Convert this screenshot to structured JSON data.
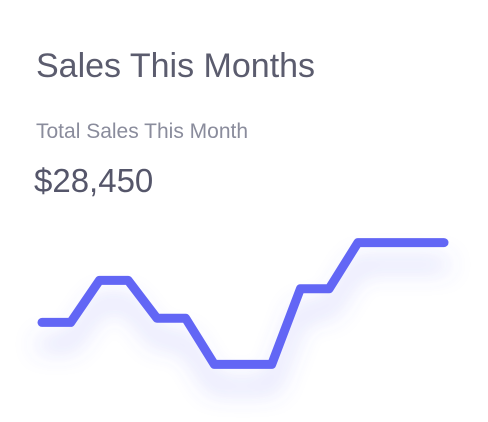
{
  "card": {
    "title": "Sales This Months",
    "subtitle": "Total Sales This Month",
    "value": "$28,450"
  },
  "colors": {
    "title": "#5b5c6e",
    "subtitle": "#8a8c9c",
    "value": "#55566a",
    "line": "#6266f5",
    "shadow": "#6266f5",
    "background": "#ffffff"
  },
  "chart_data": {
    "type": "line",
    "step_like": true,
    "x": [
      0,
      1,
      2,
      3,
      4,
      5,
      6,
      7,
      8,
      9,
      10,
      11,
      12,
      13,
      14
    ],
    "values": [
      4.3,
      4.3,
      5.3,
      5.3,
      4.4,
      4.4,
      3.3,
      3.3,
      3.3,
      5.1,
      5.1,
      6.2,
      6.2,
      6.2,
      6.2
    ],
    "xlim": [
      0,
      14
    ],
    "ylim": [
      3,
      6.5
    ],
    "grid": false,
    "axes_visible": false
  }
}
